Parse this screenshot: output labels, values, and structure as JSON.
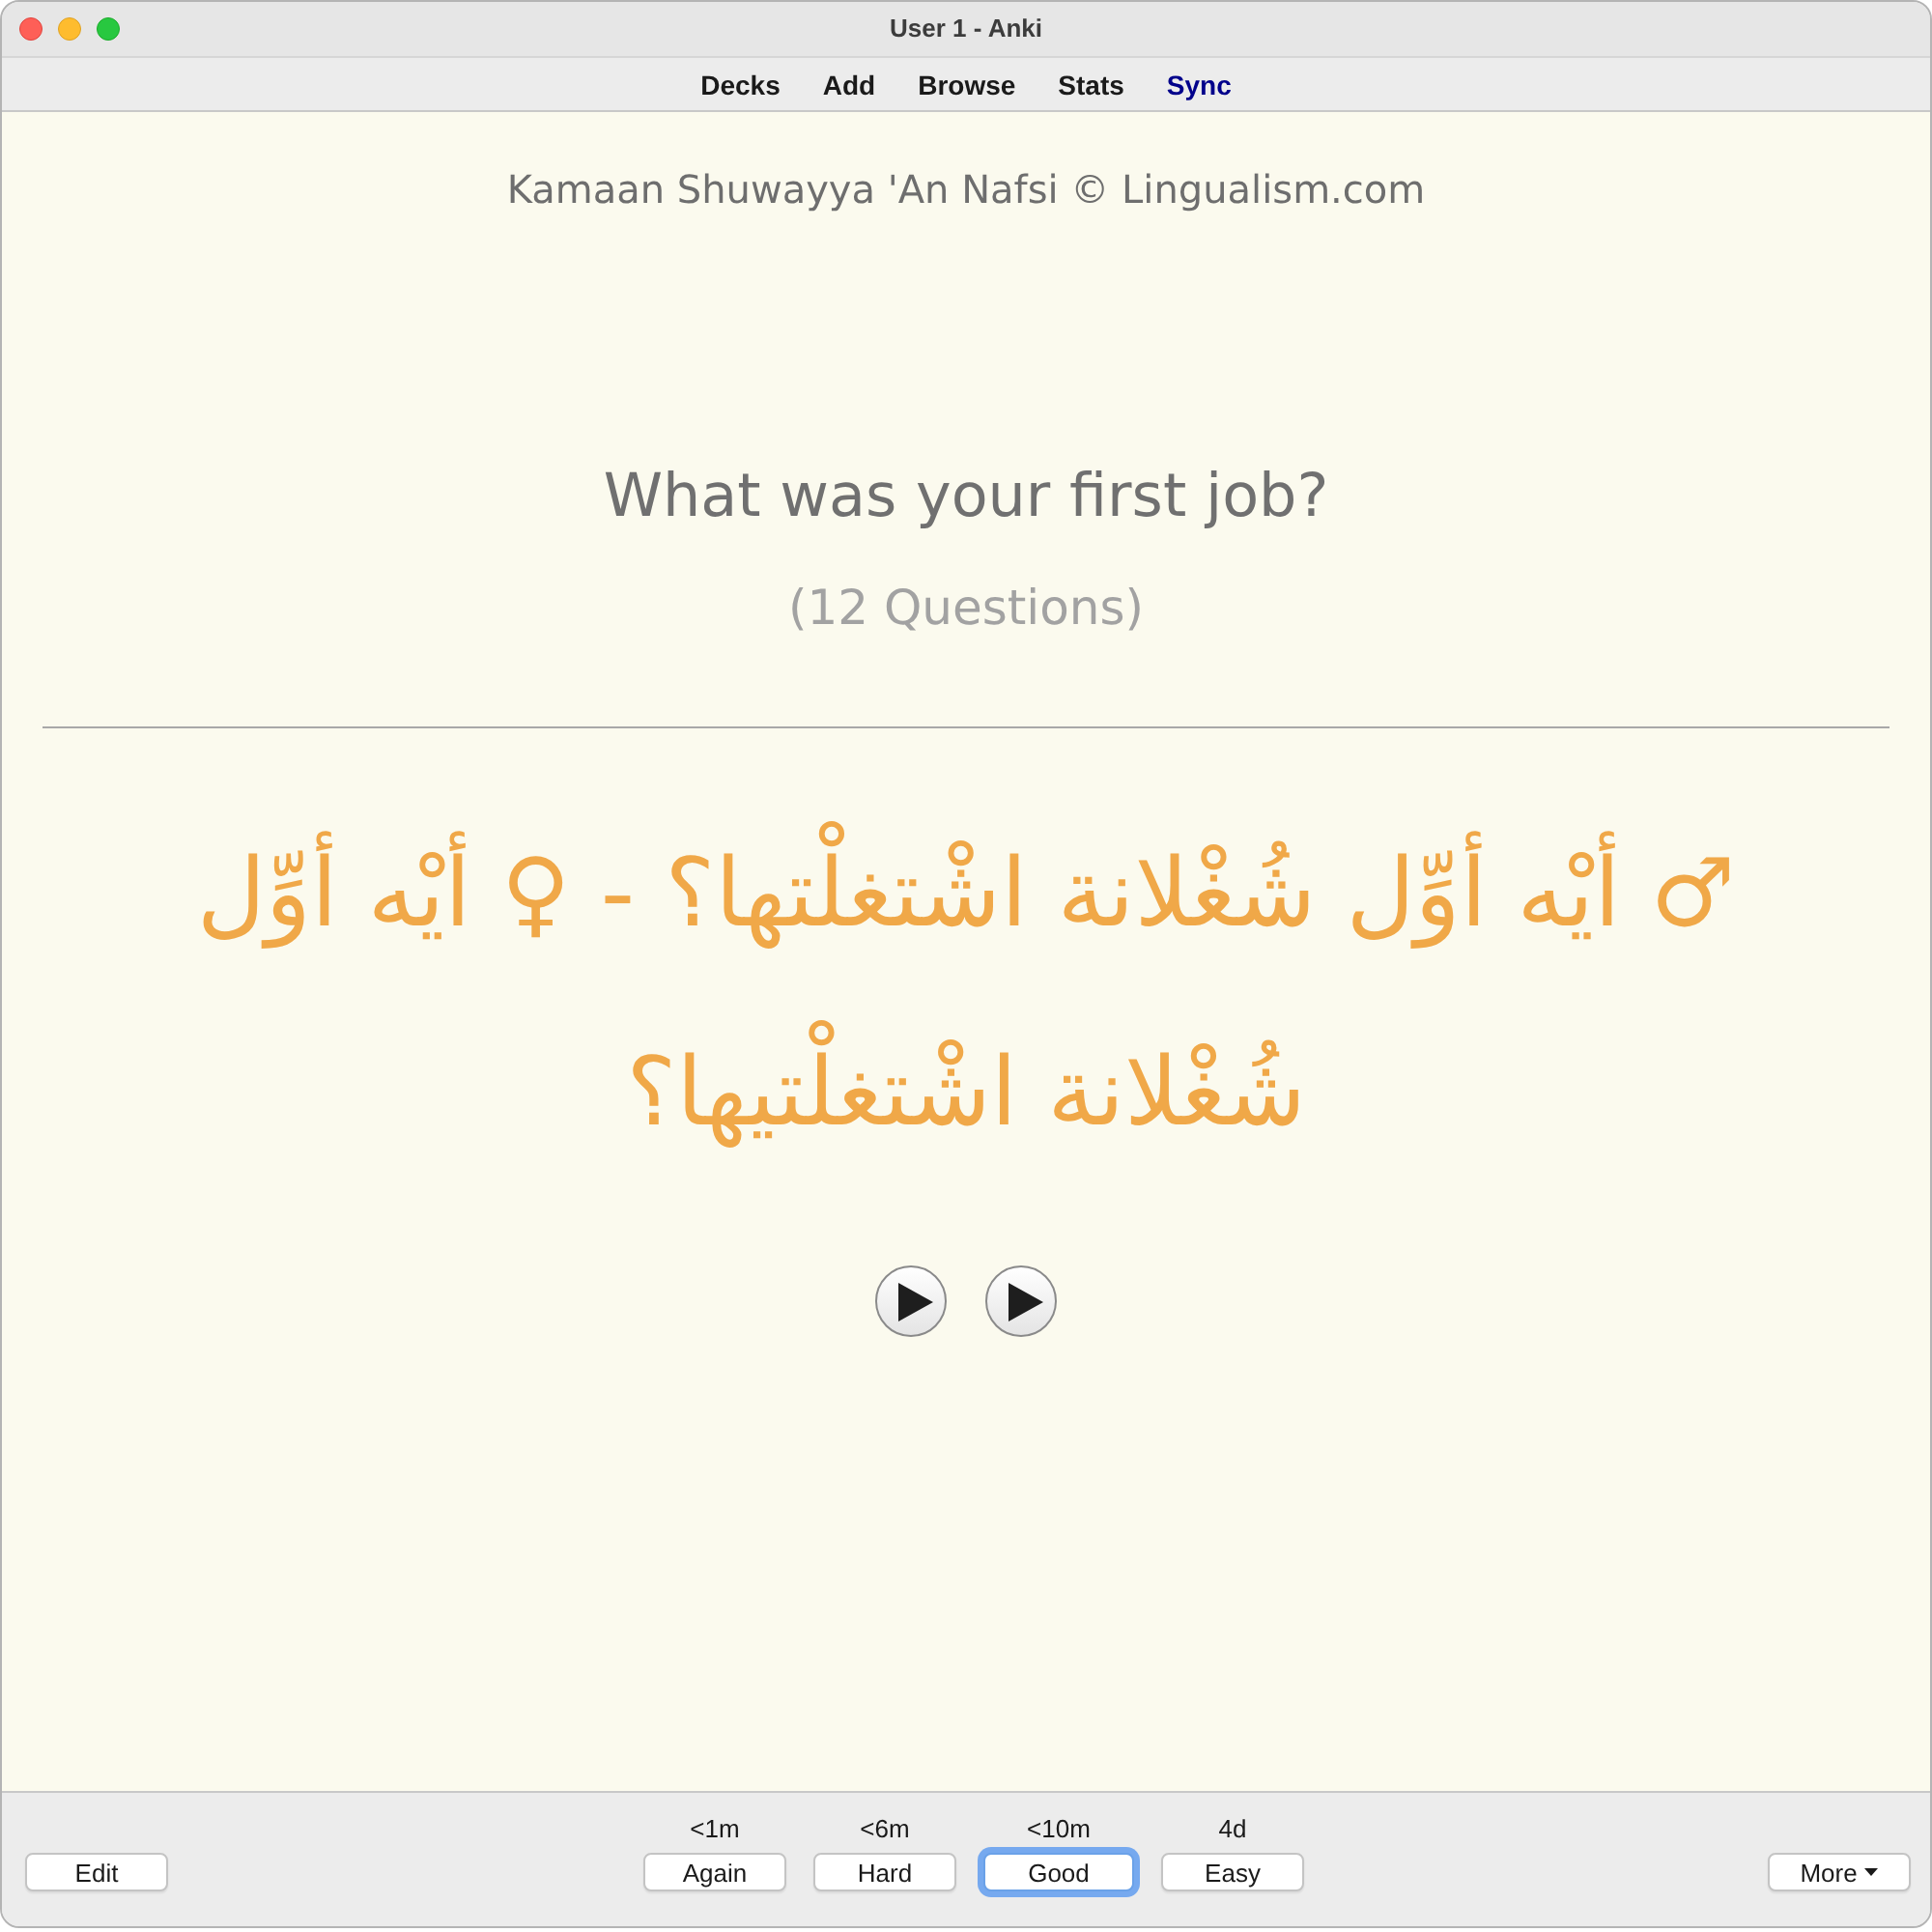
{
  "window": {
    "title": "User 1 - Anki"
  },
  "toolbar": [
    {
      "label": "Decks",
      "highlighted": false
    },
    {
      "label": "Add",
      "highlighted": false
    },
    {
      "label": "Browse",
      "highlighted": false
    },
    {
      "label": "Stats",
      "highlighted": false
    },
    {
      "label": "Sync",
      "highlighted": true
    }
  ],
  "card": {
    "deck_header": "Kamaan Shuwayya 'An Nafsi © Lingualism.com",
    "question": "What was your first job?",
    "question_count": "(12 Questions)",
    "answer": "♂ أيْه أوِّل شُغْلانة اشْتغلْتها؟ - ♀ أيْه أوِّل شُغْلانة اشْتغلْتيها؟",
    "audio_buttons": [
      {
        "kind": "play"
      },
      {
        "kind": "play"
      }
    ]
  },
  "bottom_bar": {
    "edit_button": "Edit",
    "answer_buttons": [
      {
        "interval": "<1m",
        "label": "Again",
        "focused": false
      },
      {
        "interval": "<6m",
        "label": "Hard",
        "focused": false
      },
      {
        "interval": "<10m",
        "label": "Good",
        "focused": true
      },
      {
        "interval": "4d",
        "label": "Easy",
        "focused": false
      }
    ],
    "more_button": "More"
  }
}
